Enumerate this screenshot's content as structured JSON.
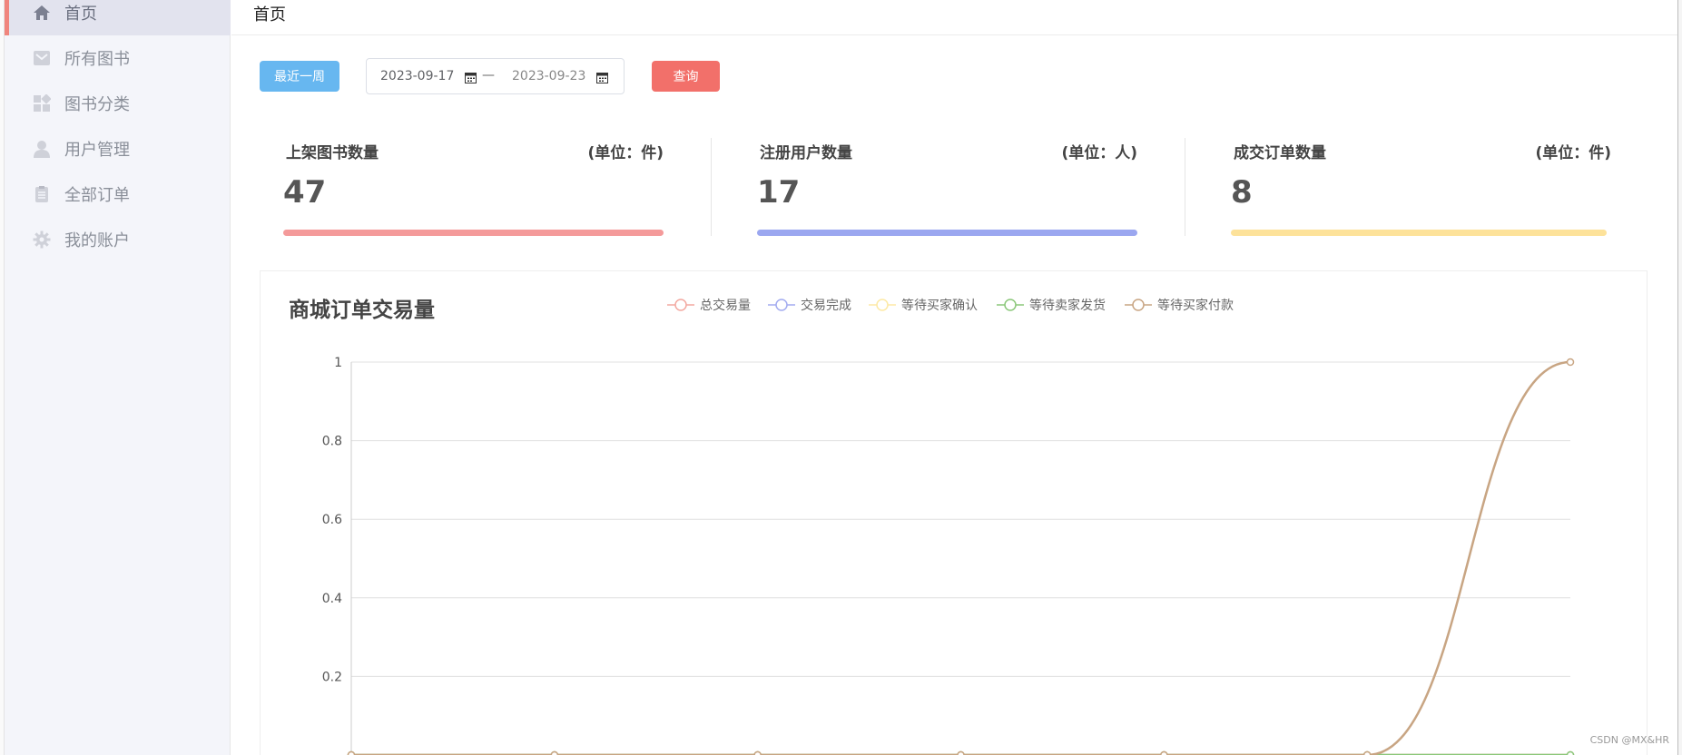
{
  "sidebar": {
    "items": [
      {
        "label": "首页",
        "icon": "home-icon",
        "active": true
      },
      {
        "label": "所有图书",
        "icon": "book-icon",
        "active": false
      },
      {
        "label": "图书分类",
        "icon": "category-icon",
        "active": false
      },
      {
        "label": "用户管理",
        "icon": "user-icon",
        "active": false
      },
      {
        "label": "全部订单",
        "icon": "orders-icon",
        "active": false
      },
      {
        "label": "我的账户",
        "icon": "gear-icon",
        "active": false
      }
    ]
  },
  "header": {
    "title": "首页"
  },
  "toolbar": {
    "recent_week_label": "最近一周",
    "date_start": "2023-09-17",
    "date_separator": "—",
    "date_end": "2023-09-23",
    "query_label": "查询"
  },
  "stats": [
    {
      "title": "上架图书数量",
      "unit": "(单位：件)",
      "value": "47",
      "color": "#f49a9a"
    },
    {
      "title": "注册用户数量",
      "unit": "(单位：人)",
      "value": "17",
      "color": "#9ba7f0"
    },
    {
      "title": "成交订单数量",
      "unit": "(单位：件)",
      "value": "8",
      "color": "#fde29a"
    }
  ],
  "chart": {
    "title": "商城订单交易量"
  },
  "chart_data": {
    "type": "line",
    "title": "商城订单交易量",
    "x": [
      "",
      "",
      "",
      "",
      "",
      "",
      ""
    ],
    "y_ticks": [
      "1",
      "0.8",
      "0.6",
      "0.4",
      "0.2"
    ],
    "ylim": [
      0,
      1
    ],
    "grid": true,
    "legend_position": "top-center",
    "series": [
      {
        "name": "总交易量",
        "color": "#f3a8a0",
        "values": [
          0,
          0,
          0,
          0,
          0,
          0,
          0
        ]
      },
      {
        "name": "交易完成",
        "color": "#a3acf0",
        "values": [
          0,
          0,
          0,
          0,
          0,
          0,
          0
        ]
      },
      {
        "name": "等待买家确认",
        "color": "#fde9a5",
        "values": [
          0,
          0,
          0,
          0,
          0,
          0,
          0
        ]
      },
      {
        "name": "等待卖家发货",
        "color": "#8bc77a",
        "values": [
          0,
          0,
          0,
          0,
          0,
          0,
          0
        ]
      },
      {
        "name": "等待买家付款",
        "color": "#c8a583",
        "values": [
          0,
          0,
          0,
          0,
          0,
          0,
          1
        ]
      }
    ]
  },
  "watermark": "CSDN @MX&HR"
}
